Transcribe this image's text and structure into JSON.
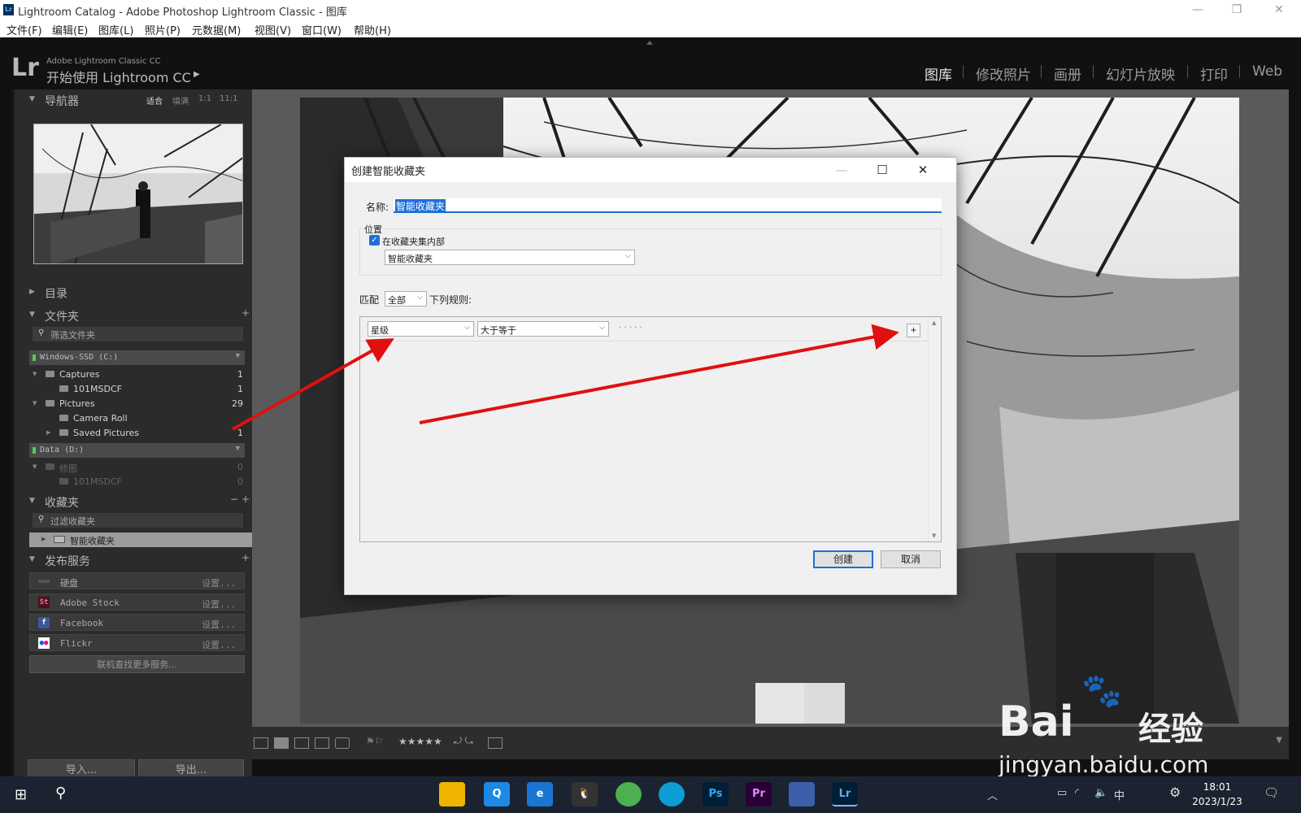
{
  "window": {
    "title": "Lightroom Catalog - Adobe Photoshop Lightroom Classic - 图库",
    "app_icon": "Lr"
  },
  "menu": [
    "文件(F)",
    "编辑(E)",
    "图库(L)",
    "照片(P)",
    "元数据(M)",
    "视图(V)",
    "窗口(W)",
    "帮助(H)"
  ],
  "identity": {
    "logo": "Lr",
    "subtitle": "Adobe Lightroom Classic CC",
    "title": "开始使用 Lightroom CC"
  },
  "modules": [
    "图库",
    "修改照片",
    "画册",
    "幻灯片放映",
    "打印",
    "Web"
  ],
  "navigator": {
    "label": "导航器",
    "zoom_options": [
      "适合",
      "填满",
      "1:1",
      "11:1"
    ]
  },
  "catalog": {
    "label": "目录"
  },
  "folders": {
    "label": "文件夹",
    "filter_placeholder": "筛选文件夹",
    "volumes": [
      {
        "name": "Windows-SSD (C:)"
      },
      {
        "name": "Data (D:)"
      }
    ],
    "items": [
      {
        "name": "Captures",
        "count": "1"
      },
      {
        "name": "101MSDCF",
        "count": "1"
      },
      {
        "name": "Pictures",
        "count": "29"
      },
      {
        "name": "Camera Roll",
        "count": ""
      },
      {
        "name": "Saved Pictures",
        "count": "1"
      },
      {
        "name": "修图",
        "count": "0"
      },
      {
        "name": "101MSDCF",
        "count": "0"
      }
    ]
  },
  "collections": {
    "label": "收藏夹",
    "filter_placeholder": "过滤收藏夹",
    "smart_collection": "智能收藏夹"
  },
  "publish": {
    "label": "发布服务",
    "services": [
      {
        "name": "硬盘",
        "setup": "设置..."
      },
      {
        "name": "Adobe Stock",
        "setup": "设置..."
      },
      {
        "name": "Facebook",
        "setup": "设置..."
      },
      {
        "name": "Flickr",
        "setup": "设置..."
      }
    ],
    "find_more": "联机查找更多服务..."
  },
  "bottom_buttons": {
    "import": "导入...",
    "export": "导出..."
  },
  "toolbar": {
    "stars": "★★★★★"
  },
  "dialog": {
    "title": "创建智能收藏夹",
    "name_label": "名称:",
    "name_value": "智能收藏夹",
    "location_label": "位置",
    "inside_set_label": "在收藏夹集内部",
    "inside_set_checked": true,
    "set_value": "智能收藏夹",
    "match_label": "匹配",
    "match_value": "全部",
    "rules_label": "下列规则:",
    "rule": {
      "field": "星级",
      "operator": "大于等于",
      "stars": "· · · · ·"
    },
    "add_rule": "+",
    "create_button": "创建",
    "cancel_button": "取消"
  },
  "taskbar": {
    "apps": [
      "Ps",
      "Pr",
      "Lr"
    ],
    "ime": "中",
    "time": "18:01",
    "date": "2023/1/23"
  },
  "watermark": {
    "brand": "Bai",
    "brand_tail": "经验",
    "url": "jingyan.baidu.com"
  },
  "colors": {
    "accent": "#1e6fd9",
    "arrow": "#e01010",
    "lr_bg": "#111111",
    "panel": "#2b2b2b"
  }
}
